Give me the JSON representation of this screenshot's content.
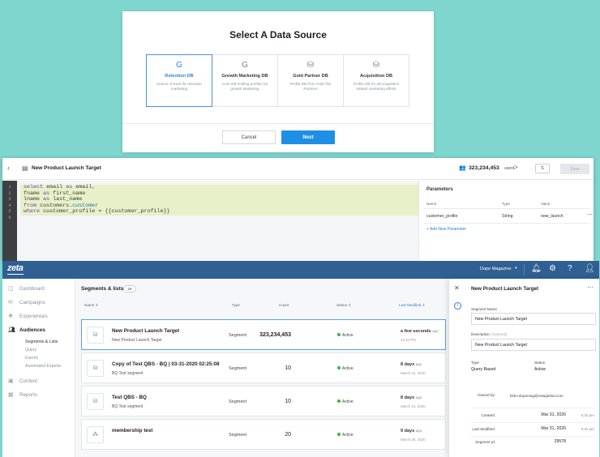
{
  "data_source": {
    "title": "Select A Data Source",
    "cards": [
      {
        "name": "Retention DB",
        "desc": "Source of truth for retention marketing",
        "icon": "google-icon",
        "selected": true
      },
      {
        "name": "Growth Marketing DB",
        "desc": "Core DB holding profiles for growth Marketing",
        "icon": "google-icon",
        "selected": false
      },
      {
        "name": "Gold Partner DB",
        "desc": "Profile DB from Gold Tier Partners",
        "icon": "database-icon",
        "selected": false
      },
      {
        "name": "Acquisition DB",
        "desc": "Profile DB for all Acquisition related marketing efforts",
        "icon": "database-icon",
        "selected": false
      }
    ],
    "cancel_label": "Cancel",
    "next_label": "Next"
  },
  "editor": {
    "title": "New Product Launch Target",
    "users_count": "323,234,453",
    "users_label": "users",
    "save_label": "Save",
    "line_numbers": [
      "1",
      "2",
      "3",
      "4",
      "5",
      "6"
    ],
    "code": {
      "l1a": "select",
      "l1b": " email ",
      "l1c": "as",
      "l1d": " email,",
      "l2a": "fname ",
      "l2b": "as",
      "l2c": " first_name",
      "l3a": "lname ",
      "l3b": "as",
      "l3c": " last_name",
      "l4a": "from",
      "l4b": " customers.",
      "l4c": "customer",
      "l5a": "where",
      "l5b": " customer_profile = {{customer_profile}}"
    },
    "parameters": {
      "title": "Parameters",
      "headers": {
        "name": "Name",
        "type": "Type",
        "value": "Value"
      },
      "rows": [
        {
          "name": "customer_profile",
          "type": "String",
          "value": "new_launch"
        }
      ],
      "add_label": "Add New Parameter"
    }
  },
  "app": {
    "logo": "zeta",
    "org": "Dope Magazine",
    "nav": [
      {
        "label": "Dashboard",
        "icon": "dashboard-icon"
      },
      {
        "label": "Campaigns",
        "icon": "campaigns-icon"
      },
      {
        "label": "Experiences",
        "icon": "experiences-icon"
      },
      {
        "label": "Audiences",
        "icon": "audiences-icon",
        "active": true
      },
      {
        "label": "Content",
        "icon": "content-icon"
      },
      {
        "label": "Reports",
        "icon": "reports-icon"
      }
    ],
    "subnav": [
      {
        "label": "Segments & Lists",
        "active": true
      },
      {
        "label": "Query"
      },
      {
        "label": "Events"
      },
      {
        "label": "Automated Exports"
      }
    ],
    "list": {
      "title": "Segments & lists",
      "count": "29",
      "headers": {
        "name": "Name",
        "type": "Type",
        "count": "Count",
        "status": "Status",
        "modified": "Last Modified"
      },
      "rows": [
        {
          "name": "New Product Launch Target",
          "desc": "New Product Launch Target",
          "type": "Segment",
          "count": "323,234,453",
          "status": "Active",
          "mod": "a few seconds",
          "ago": "ago",
          "mod_sub": "12:34 PM"
        },
        {
          "name": "Copy of Test QBS - BQ | 03-31-2020 02:25:08",
          "desc": "BQ Test segment",
          "type": "Segment",
          "count": "10",
          "status": "Active",
          "mod": "8 days",
          "ago": "ago",
          "mod_sub": "March 31, 2020"
        },
        {
          "name": "Test QBS - BQ",
          "desc": "BQ Test segment",
          "type": "Segment",
          "count": "10",
          "status": "Active",
          "mod": "8 days",
          "ago": "ago",
          "mod_sub": "March 31, 2020"
        },
        {
          "name": "membership test",
          "desc": "",
          "type": "Segment",
          "count": "20",
          "status": "Active",
          "mod": "9 days",
          "ago": "ago",
          "mod_sub": "March 30, 2020"
        }
      ]
    },
    "detail": {
      "title": "New Product Launch Target",
      "segment_name_label": "Segment Name",
      "segment_name": "New Product Launch Target",
      "description_label": "Description",
      "description_hint": "(Optional)",
      "description": "New Product Launch Target",
      "type_label": "Type",
      "type": "Query Based",
      "status_label": "Status",
      "status": "Active",
      "owned_by_label": "Owned by:",
      "owned_by": "blitz+dopemag@zetaglobal.com",
      "created_label": "Created:",
      "created": "Mar 31, 2020",
      "created_time": "5:42 pm",
      "modified_label": "Last Modified:",
      "modified": "Mar 31, 2020",
      "modified_time": "5:42 pm",
      "segment_id_label": "Segment Id:",
      "segment_id": "29578"
    }
  }
}
